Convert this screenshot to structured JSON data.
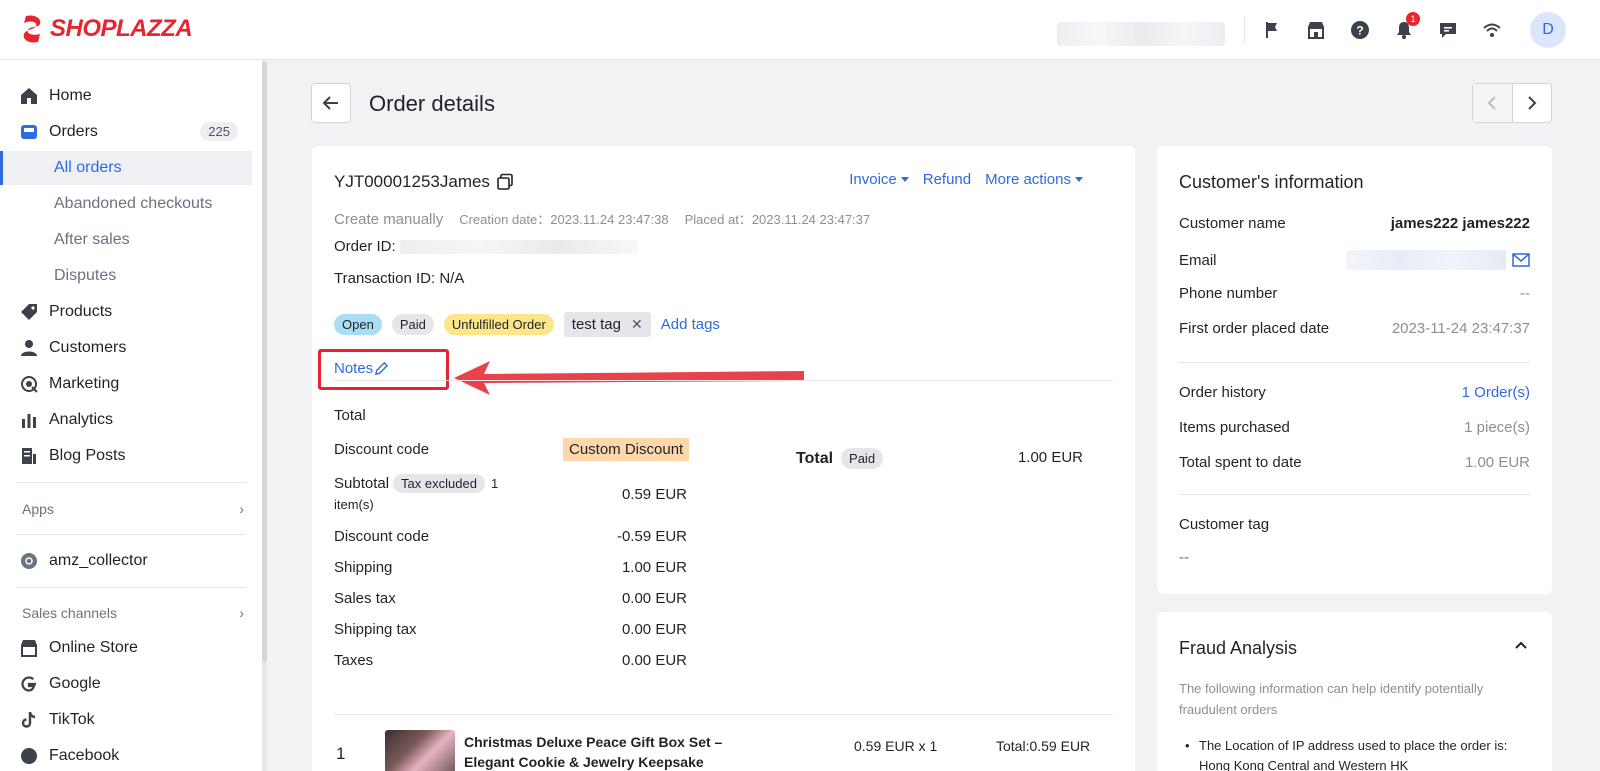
{
  "brand": {
    "name": "SHOPLAZZA",
    "color": "#e8252e",
    "accent": "#2f6bde"
  },
  "topbar": {
    "icons": [
      "flag-icon",
      "store-icon",
      "help-icon",
      "bell-icon",
      "chat-icon",
      "wifi-icon"
    ],
    "notification_count": "1",
    "avatar_initial": "D"
  },
  "sidebar": {
    "items": [
      {
        "label": "Home",
        "icon": "home-icon"
      },
      {
        "label": "Orders",
        "icon": "orders-icon",
        "count": "225"
      },
      {
        "label": "All orders"
      },
      {
        "label": "Abandoned checkouts"
      },
      {
        "label": "After sales"
      },
      {
        "label": "Disputes"
      },
      {
        "label": "Products",
        "icon": "tag-icon"
      },
      {
        "label": "Customers",
        "icon": "person-icon"
      },
      {
        "label": "Marketing",
        "icon": "marketing-icon"
      },
      {
        "label": "Analytics",
        "icon": "analytics-icon"
      },
      {
        "label": "Blog Posts",
        "icon": "blog-icon"
      }
    ],
    "apps_label": "Apps",
    "app_item": "amz_collector",
    "sales_channels_label": "Sales channels",
    "channels": [
      "Online Store",
      "Google",
      "TikTok",
      "Facebook"
    ]
  },
  "page": {
    "title": "Order details"
  },
  "order": {
    "number": "YJT00001253James",
    "actions": {
      "invoice": "Invoice",
      "refund": "Refund",
      "more": "More actions"
    },
    "source": "Create manually",
    "creation_label": "Creation date：",
    "creation_date": "2023.11.24 23:47:38",
    "placed_label": "Placed at：",
    "placed_date": "2023.11.24 23:47:37",
    "order_id_label": "Order ID:",
    "transaction_label": "Transaction ID: N/A",
    "statuses": {
      "open": "Open",
      "paid": "Paid",
      "unfulfilled": "Unfulfilled Order"
    },
    "tag": "test tag",
    "add_tags": "Add tags",
    "notes": "Notes"
  },
  "summary": {
    "title": "Total",
    "discount_code_label": "Discount code",
    "discount_name": "Custom Discount",
    "subtotal_label": "Subtotal",
    "tax_excluded": "Tax excluded",
    "items_count_a": "1",
    "items_count_b": "item(s)",
    "subtotal_value": "0.59 EUR",
    "discount_label": "Discount code",
    "discount_value": "-0.59 EUR",
    "shipping_label": "Shipping",
    "shipping_value": "1.00 EUR",
    "sales_tax_label": "Sales tax",
    "sales_tax_value": "0.00 EUR",
    "shipping_tax_label": "Shipping tax",
    "shipping_tax_value": "0.00 EUR",
    "taxes_label": "Taxes",
    "taxes_value": "0.00 EUR",
    "total_label": "Total",
    "total_status": "Paid",
    "total_value": "1.00 EUR"
  },
  "product": {
    "index": "1",
    "name": "Christmas Deluxe Peace Gift Box Set – Elegant Cookie & Jewelry Keepsake",
    "qty": "0.59 EUR x 1",
    "total": "Total:0.59 EUR"
  },
  "customer": {
    "title": "Customer's information",
    "name_label": "Customer name",
    "name_value": "james222 james222",
    "email_label": "Email",
    "phone_label": "Phone number",
    "phone_value": "--",
    "first_order_label": "First order placed date",
    "first_order_value": "2023-11-24 23:47:37",
    "history_label": "Order history",
    "history_value": "1 Order(s)",
    "items_label": "Items purchased",
    "items_value": "1 piece(s)",
    "spent_label": "Total spent to date",
    "spent_value": "1.00 EUR",
    "tag_label": "Customer tag",
    "tag_value": "--"
  },
  "fraud": {
    "title": "Fraud Analysis",
    "desc": "The following information can help identify potentially fraudulent orders",
    "item": "The Location of IP address used to place the order is: Hong Kong Central and Western HK"
  }
}
